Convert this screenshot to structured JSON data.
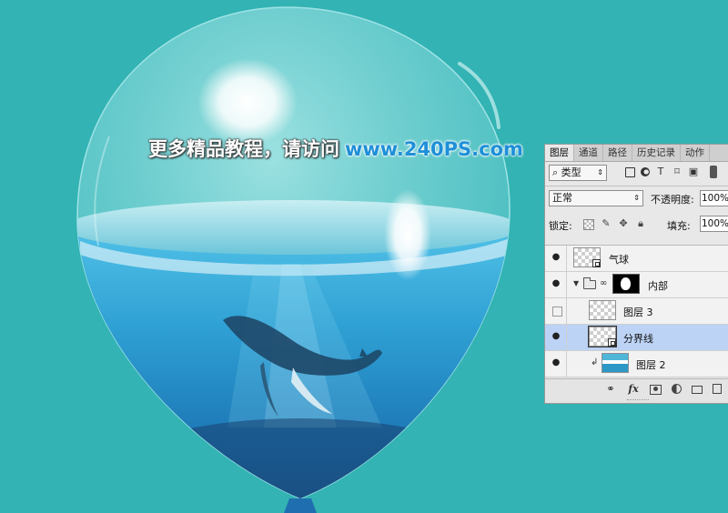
{
  "watermark": {
    "chinese": "更多精品教程，请访问",
    "url": "www.240PS.com"
  },
  "layers_panel": {
    "tabs": [
      "图层",
      "通道",
      "路径",
      "历史记录",
      "动作"
    ],
    "active_tab": "图层",
    "filter_kind": "类型",
    "blend_mode": "正常",
    "opacity_label": "不透明度:",
    "opacity_value": "100%",
    "lock_label": "锁定:",
    "fill_label": "填充:",
    "fill_value": "100%",
    "layers": [
      {
        "name": "气球",
        "visible": true
      },
      {
        "name": "内部",
        "visible": true
      },
      {
        "name": "图层 3",
        "visible": false
      },
      {
        "name": "分界线",
        "visible": true,
        "selected": true
      },
      {
        "name": "图层 2",
        "visible": true
      }
    ]
  },
  "colors": {
    "background": "#33b3b3",
    "selected_row": "#bcd3f5",
    "watermark_url": "#1f8fd8"
  }
}
